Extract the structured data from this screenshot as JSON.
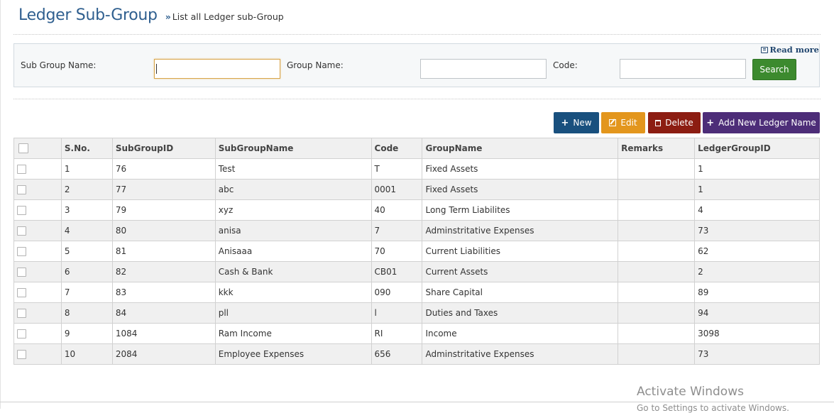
{
  "header": {
    "title": "Ledger Sub-Group",
    "subtitle_marker": "»",
    "subtitle": "List all Ledger sub-Group"
  },
  "search": {
    "read_more": "Read more",
    "sub_group_label": "Sub Group Name:",
    "sub_group_value": "",
    "group_label": "Group Name:",
    "group_value": "",
    "code_label": "Code:",
    "code_value": "",
    "search_button": "Search"
  },
  "toolbar": {
    "new_icon": "+",
    "new_label": "New",
    "edit_label": "Edit",
    "delete_label": "Delete",
    "add_icon": "+",
    "add_label": "Add New Ledger Name"
  },
  "table": {
    "columns": [
      "S.No.",
      "SubGroupID",
      "SubGroupName",
      "Code",
      "GroupName",
      "Remarks",
      "LedgerGroupID"
    ],
    "rows": [
      {
        "sno": "1",
        "id": "76",
        "name": "Test",
        "code": "T",
        "group": "Fixed Assets",
        "remarks": "",
        "lgid": "1"
      },
      {
        "sno": "2",
        "id": "77",
        "name": "abc",
        "code": "0001",
        "group": "Fixed Assets",
        "remarks": "",
        "lgid": "1"
      },
      {
        "sno": "3",
        "id": "79",
        "name": "xyz",
        "code": "40",
        "group": "Long Term Liabilites",
        "remarks": "",
        "lgid": "4"
      },
      {
        "sno": "4",
        "id": "80",
        "name": "anisa",
        "code": "7",
        "group": "Adminstritative Expenses",
        "remarks": "",
        "lgid": "73"
      },
      {
        "sno": "5",
        "id": "81",
        "name": "Anisaaa",
        "code": "70",
        "group": "Current Liabilities",
        "remarks": "",
        "lgid": "62"
      },
      {
        "sno": "6",
        "id": "82",
        "name": "Cash & Bank",
        "code": "CB01",
        "group": "Current Assets",
        "remarks": "",
        "lgid": "2"
      },
      {
        "sno": "7",
        "id": "83",
        "name": "kkk",
        "code": "090",
        "group": "Share Capital",
        "remarks": "",
        "lgid": "89"
      },
      {
        "sno": "8",
        "id": "84",
        "name": "pll",
        "code": "l",
        "group": "Duties and Taxes",
        "remarks": "",
        "lgid": "94"
      },
      {
        "sno": "9",
        "id": "1084",
        "name": "Ram Income",
        "code": "RI",
        "group": "Income",
        "remarks": "",
        "lgid": "3098"
      },
      {
        "sno": "10",
        "id": "2084",
        "name": "Employee Expenses",
        "code": "656",
        "group": "Adminstritative Expenses",
        "remarks": "",
        "lgid": "73"
      }
    ]
  },
  "watermark": {
    "line1": "Activate Windows",
    "line2": "Go to Settings to activate Windows."
  },
  "colors": {
    "title": "#2f5f8f",
    "search_button": "#3c8a2e",
    "new_button": "#19507e",
    "edit_button": "#e3961d",
    "delete_button": "#8c1d12",
    "add_button": "#4d2d78"
  }
}
